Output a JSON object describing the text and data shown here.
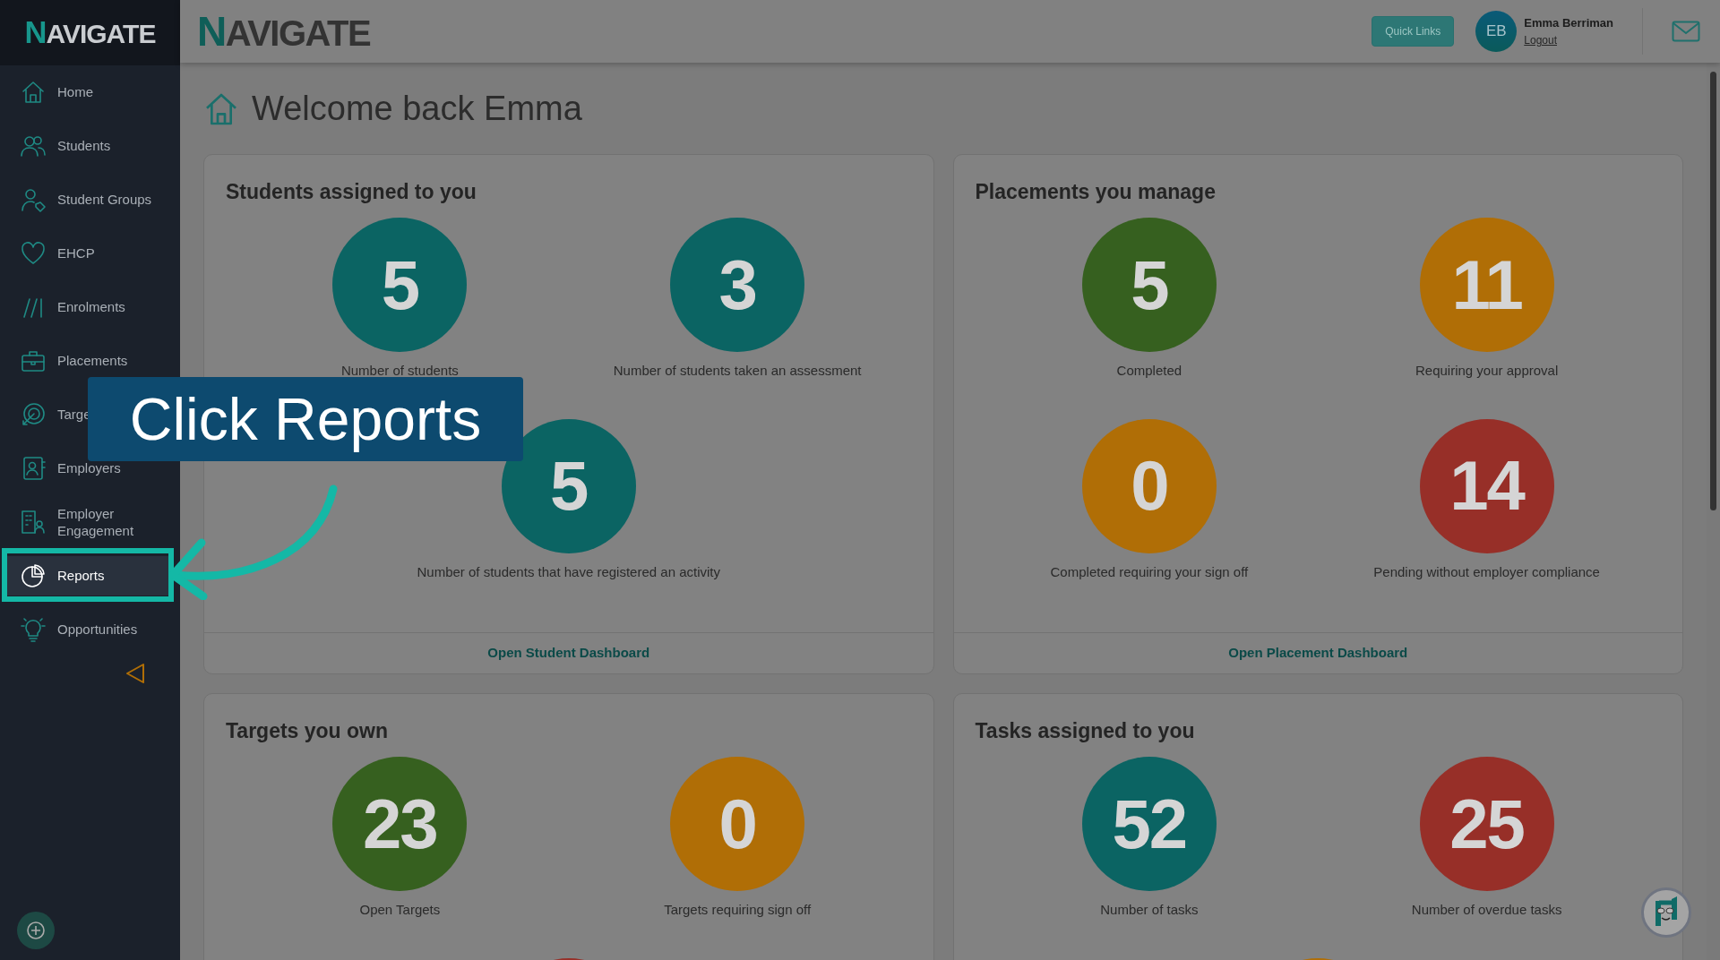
{
  "sidebar": {
    "logo": "NAVIGATE",
    "items": [
      {
        "label": "Home",
        "selected": false
      },
      {
        "label": "Students",
        "selected": false
      },
      {
        "label": "Student Groups",
        "selected": false
      },
      {
        "label": "EHCP",
        "selected": false
      },
      {
        "label": "Enrolments",
        "selected": false
      },
      {
        "label": "Placements",
        "selected": false
      },
      {
        "label": "Targe",
        "selected": false
      },
      {
        "label": "Employers",
        "selected": false
      },
      {
        "label": "Employer Engagement",
        "selected": false
      },
      {
        "label": "Reports",
        "selected": true
      },
      {
        "label": "Opportunities",
        "selected": false
      }
    ]
  },
  "header": {
    "logo": "NAVIGATE",
    "quick_links": "Quick Links",
    "user": {
      "initials": "EB",
      "name": "Emma Berriman",
      "logout": "Logout"
    }
  },
  "page": {
    "title": "Welcome back Emma"
  },
  "cards": [
    {
      "title": "Students assigned to you",
      "footer_link": "Open Student Dashboard",
      "stats": [
        {
          "value": "5",
          "label": "Number of students",
          "color": "#0b6463"
        },
        {
          "value": "3",
          "label": "Number of students taken an assessment",
          "color": "#0b6463"
        },
        {
          "value": "5",
          "label": "Number of students that have registered an activity",
          "color": "#0b6463"
        }
      ]
    },
    {
      "title": "Placements you manage",
      "footer_link": "Open Placement Dashboard",
      "stats": [
        {
          "value": "5",
          "label": "Completed",
          "color": "#36601f"
        },
        {
          "value": "11",
          "label": "Requiring your approval",
          "color": "#b06e06"
        },
        {
          "value": "0",
          "label": "Completed requiring your sign off",
          "color": "#b06e06"
        },
        {
          "value": "14",
          "label": "Pending without employer compliance",
          "color": "#972f28"
        }
      ]
    },
    {
      "title": "Targets you own",
      "stats": [
        {
          "value": "23",
          "label": "Open Targets",
          "color": "#36601f"
        },
        {
          "value": "0",
          "label": "Targets requiring sign off",
          "color": "#b06e06"
        },
        {
          "color": "#972f28"
        }
      ]
    },
    {
      "title": "Tasks assigned to you",
      "stats": [
        {
          "value": "52",
          "label": "Number of tasks",
          "color": "#0b6463"
        },
        {
          "value": "25",
          "label": "Number of overdue tasks",
          "color": "#972f28"
        },
        {
          "color": "#b06e06"
        }
      ]
    }
  ],
  "callout": {
    "text": "Click Reports"
  }
}
